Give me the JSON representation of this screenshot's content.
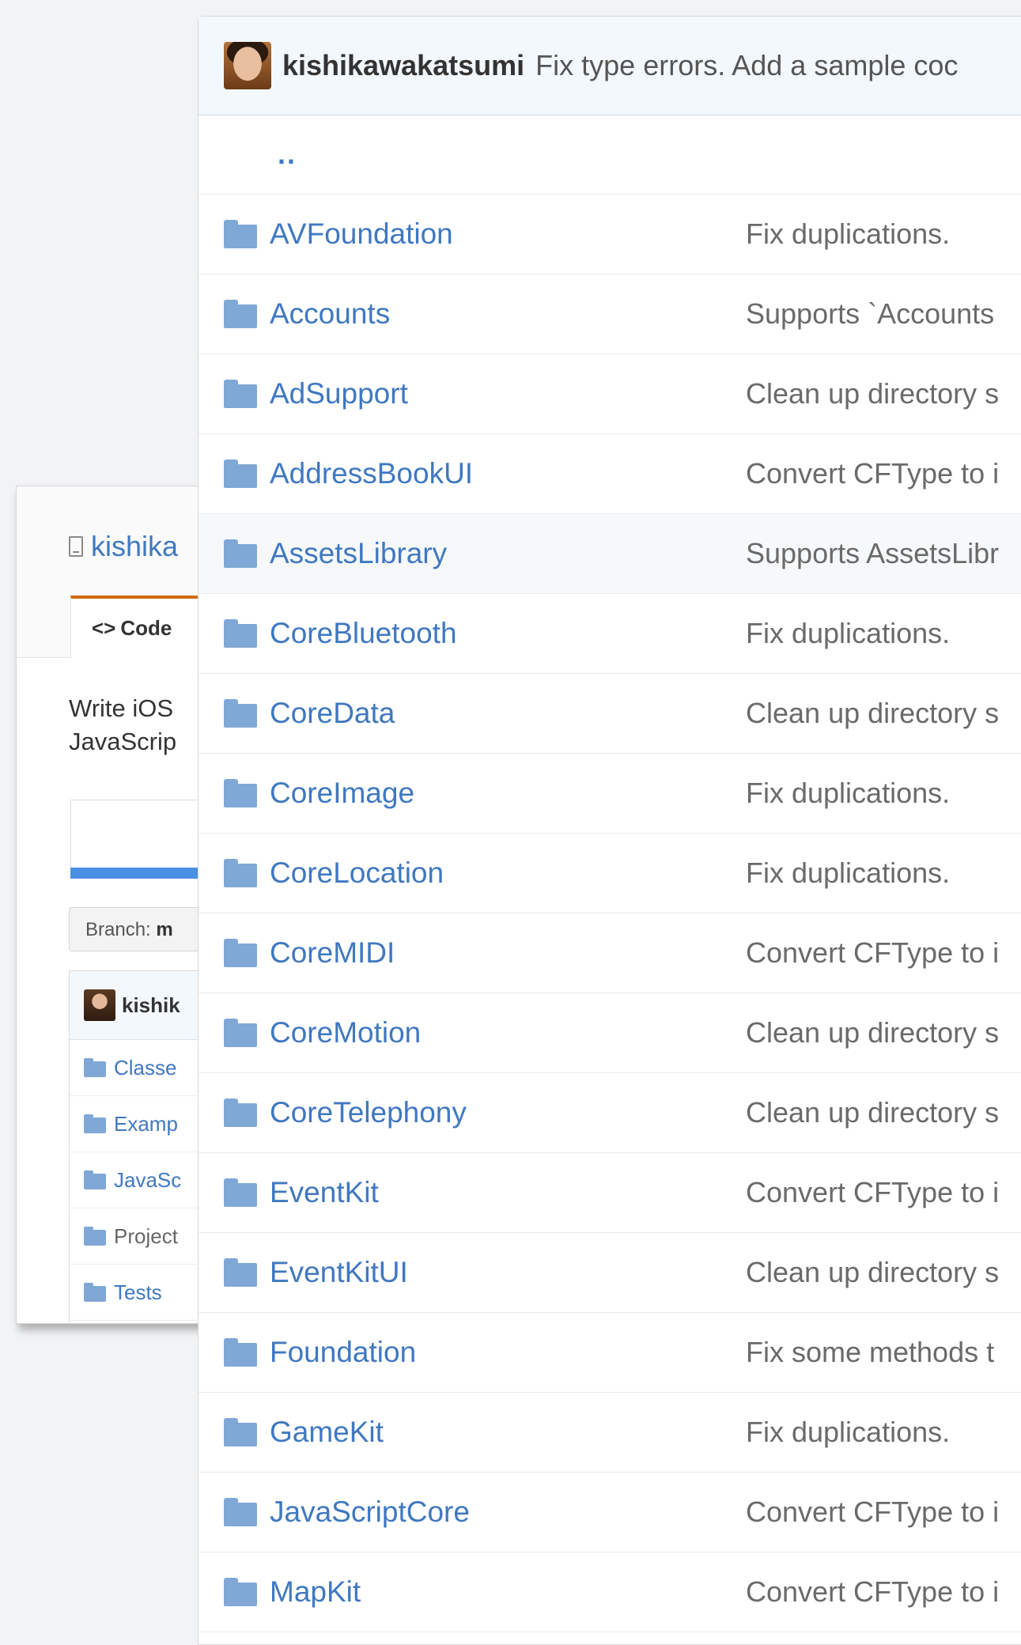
{
  "back_window": {
    "repo_name": "kishika",
    "tab_code_label": "Code",
    "description_line1": "Write iOS",
    "description_line2": "JavaScrip",
    "branch_label": "Branch:",
    "branch_value": "m",
    "commit_author": "kishik",
    "items": [
      {
        "label": "Classe",
        "link": true
      },
      {
        "label": "Examp",
        "link": true
      },
      {
        "label": "JavaSc",
        "link": true
      },
      {
        "label": "Project",
        "link": false
      },
      {
        "label": "Tests",
        "link": true
      }
    ]
  },
  "front_panel": {
    "commit": {
      "author": "kishikawakatsumi",
      "message": "Fix type errors. Add a sample coc"
    },
    "parent_link": "..",
    "rows": [
      {
        "name": "AVFoundation",
        "message": "Fix duplications."
      },
      {
        "name": "Accounts",
        "message": "Supports `Accounts"
      },
      {
        "name": "AdSupport",
        "message": "Clean up directory s"
      },
      {
        "name": "AddressBookUI",
        "message": "Convert CFType to i"
      },
      {
        "name": "AssetsLibrary",
        "message": "Supports AssetsLibr"
      },
      {
        "name": "CoreBluetooth",
        "message": "Fix duplications."
      },
      {
        "name": "CoreData",
        "message": "Clean up directory s"
      },
      {
        "name": "CoreImage",
        "message": "Fix duplications."
      },
      {
        "name": "CoreLocation",
        "message": "Fix duplications."
      },
      {
        "name": "CoreMIDI",
        "message": "Convert CFType to i"
      },
      {
        "name": "CoreMotion",
        "message": "Clean up directory s"
      },
      {
        "name": "CoreTelephony",
        "message": "Clean up directory s"
      },
      {
        "name": "EventKit",
        "message": "Convert CFType to i"
      },
      {
        "name": "EventKitUI",
        "message": "Clean up directory s"
      },
      {
        "name": "Foundation",
        "message": "Fix some methods t"
      },
      {
        "name": "GameKit",
        "message": "Fix duplications."
      },
      {
        "name": "JavaScriptCore",
        "message": "Convert CFType to i"
      },
      {
        "name": "MapKit",
        "message": "Convert CFType to i"
      }
    ]
  },
  "icons": {
    "folder": "folder-icon",
    "repo": "repo-icon",
    "code": "code-icon",
    "avatar": "avatar"
  },
  "colors": {
    "link": "#4078c0",
    "commit_bar_bg": "#f2f8fc",
    "folder": "#80a8d6",
    "tab_accent": "#d26911",
    "language_bar": "#4a90e2"
  }
}
